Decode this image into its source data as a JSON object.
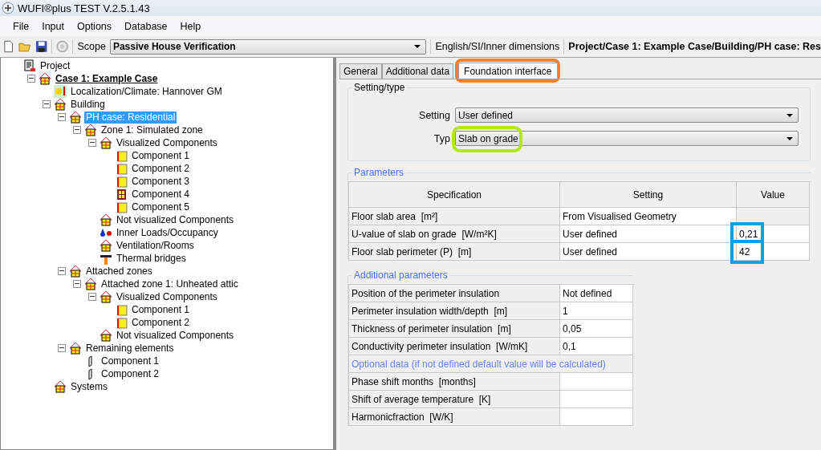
{
  "window": {
    "title": "WUFI®plus TEST V.2.5.1.43"
  },
  "menu": [
    "File",
    "Input",
    "Options",
    "Database",
    "Help"
  ],
  "toolbar": {
    "scope_label": "Scope",
    "scope": "Passive House Verification",
    "units": "English/SI/Inner dimensions",
    "path": "Project/Case 1: Example Case/Building/PH case: Res"
  },
  "tree": [
    {
      "label": "Project",
      "kind": "document",
      "selected": false,
      "children": [
        {
          "label": "Case 1: Example Case",
          "kind": "case",
          "expanded": true,
          "selected": false,
          "children": [
            {
              "label": "Localization/Climate: Hannover GM",
              "kind": "climate",
              "selected": false
            },
            {
              "label": "Building",
              "kind": "house",
              "expanded": true,
              "selected": false,
              "children": [
                {
                  "label": "PH case: Residential",
                  "kind": "house",
                  "expanded": true,
                  "selected": true,
                  "children": [
                    {
                      "label": "Zone 1: Simulated zone",
                      "kind": "house",
                      "expanded": true,
                      "selected": false,
                      "children": [
                        {
                          "label": "Visualized Components",
                          "kind": "house",
                          "expanded": true,
                          "selected": false,
                          "children": [
                            {
                              "label": "Component 1",
                              "kind": "component",
                              "selected": false
                            },
                            {
                              "label": "Component 2",
                              "kind": "component",
                              "selected": false
                            },
                            {
                              "label": "Component 3",
                              "kind": "component",
                              "selected": false
                            },
                            {
                              "label": "Component 4",
                              "kind": "window",
                              "selected": false
                            },
                            {
                              "label": "Component 5",
                              "kind": "component",
                              "selected": false
                            }
                          ]
                        },
                        {
                          "label": "Not visualized Components",
                          "kind": "house",
                          "selected": false
                        },
                        {
                          "label": "Inner Loads/Occupancy",
                          "kind": "loads",
                          "selected": false
                        },
                        {
                          "label": "Ventilation/Rooms",
                          "kind": "house",
                          "selected": false
                        },
                        {
                          "label": "Thermal bridges",
                          "kind": "bridge",
                          "selected": false
                        }
                      ]
                    }
                  ]
                },
                {
                  "label": "Attached zones",
                  "kind": "house",
                  "expanded": true,
                  "selected": false,
                  "children": [
                    {
                      "label": "Attached zone 1: Unheated attic",
                      "kind": "house",
                      "expanded": true,
                      "selected": false,
                      "children": [
                        {
                          "label": "Visualized Components",
                          "kind": "house",
                          "expanded": true,
                          "selected": false,
                          "children": [
                            {
                              "label": "Component 1",
                              "kind": "component",
                              "selected": false
                            },
                            {
                              "label": "Component 2",
                              "kind": "component",
                              "selected": false
                            }
                          ]
                        },
                        {
                          "label": "Not visualized Components",
                          "kind": "house",
                          "selected": false
                        }
                      ]
                    }
                  ]
                },
                {
                  "label": "Remaining elements",
                  "kind": "house",
                  "expanded": true,
                  "selected": false,
                  "children": [
                    {
                      "label": "Component 1",
                      "kind": "element",
                      "selected": false
                    },
                    {
                      "label": "Component 2",
                      "kind": "element",
                      "selected": false
                    }
                  ]
                }
              ]
            },
            {
              "label": "Systems",
              "kind": "house",
              "selected": false
            }
          ]
        }
      ]
    }
  ],
  "tabs": [
    {
      "label": "General",
      "selected": false
    },
    {
      "label": "Additional data",
      "selected": false
    },
    {
      "label": "Foundation interface",
      "selected": true,
      "color": "#ff7f27"
    }
  ],
  "setting_type": {
    "legend": "Setting/type",
    "fields": [
      {
        "label": "Setting",
        "value": "User defined"
      },
      {
        "label": "Typ",
        "value": "Slab on grade",
        "color": "#b5e61d"
      }
    ]
  },
  "parameters": {
    "legend": "Parameters",
    "columns": [
      "Specification",
      "Setting",
      "Value"
    ],
    "rows": [
      {
        "spec": "Floor slab area  [m²]",
        "setting": "From Visualised Geometry"
      },
      {
        "spec": "U-value of slab on grade  [W/m²K]",
        "setting": "User defined",
        "value": "0,21",
        "color": "#00a2e8"
      },
      {
        "spec": "Floor slab perimeter (P)  [m]",
        "setting": "User defined",
        "value": "42",
        "color": "#00a2e8"
      }
    ]
  },
  "additional": {
    "legend": "Additional parameters",
    "rows": [
      {
        "kind": "value",
        "label": "Position of the perimeter insulation",
        "value": "Not defined"
      },
      {
        "kind": "value",
        "label": "Perimeter insulation width/depth  [m]",
        "value": "1"
      },
      {
        "kind": "value",
        "label": "Thickness of perimeter insulation  [m]",
        "value": "0,05"
      },
      {
        "kind": "value",
        "label": "Conductivity perimeter insulation  [W/mK]",
        "value": "0,1"
      },
      {
        "kind": "note",
        "label": "Optional data (if not defined default value will be calculated)"
      },
      {
        "kind": "value",
        "label": "Phase shift months  [months]"
      },
      {
        "kind": "value",
        "label": "Shift of average temperature  [K]"
      },
      {
        "kind": "value",
        "label": "Harmonicfraction  [W/K]"
      }
    ]
  }
}
